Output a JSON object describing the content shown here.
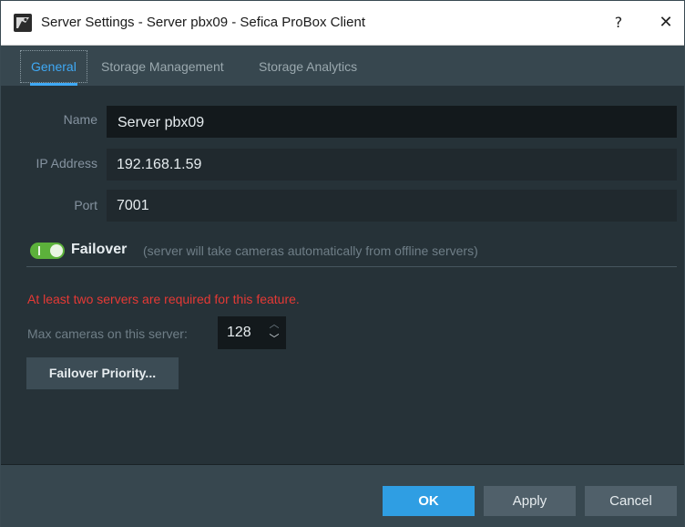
{
  "window": {
    "title": "Server Settings - Server pbx09 - Sefica ProBox Client",
    "help_label": "?",
    "close_label": "✕",
    "app_icon": "camera-app-icon"
  },
  "tabs": [
    {
      "label": "General",
      "active": true
    },
    {
      "label": "Storage Management",
      "active": false
    },
    {
      "label": "Storage Analytics",
      "active": false
    }
  ],
  "form": {
    "name_label": "Name",
    "name_value": "Server pbx09",
    "ip_label": "IP Address",
    "ip_value": "192.168.1.59",
    "port_label": "Port",
    "port_value": "7001"
  },
  "failover": {
    "enabled": true,
    "label": "Failover",
    "description": "(server will take cameras automatically from offline servers)",
    "error": "At least two servers are required for this feature.",
    "max_cameras_label": "Max cameras on this server:",
    "max_cameras_value": "128",
    "priority_button": "Failover Priority..."
  },
  "footer": {
    "ok": "OK",
    "apply": "Apply",
    "cancel": "Cancel"
  },
  "colors": {
    "accent": "#3fa9f5",
    "toggle_on": "#5cb13b",
    "error": "#e53935",
    "background": "#263238"
  }
}
